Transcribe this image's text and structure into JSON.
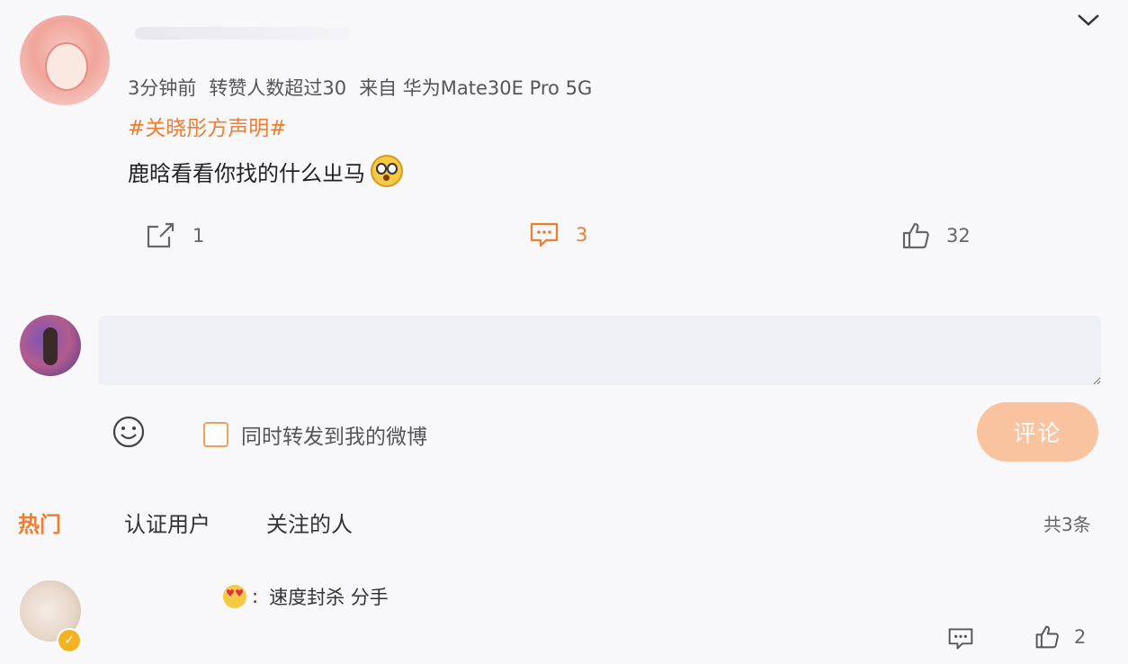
{
  "post": {
    "meta_time": "3分钟前",
    "meta_popular": "转赞人数超过30",
    "meta_source": "来自 华为Mate30E Pro 5G",
    "hashtag": "#关晓彤方声明#",
    "text": "鹿晗看看你找的什么ㄓ马",
    "emoji": "shock-face-emoji",
    "repost_count": "1",
    "comment_count": "3",
    "like_count": "32"
  },
  "composer": {
    "placeholder": "",
    "forward_label": "同时转发到我的微博",
    "submit_label": "评论"
  },
  "comments_header": {
    "tabs": [
      "热门",
      "认证用户",
      "关注的人"
    ],
    "active_tab": "热门",
    "total": "共3条"
  },
  "reply": {
    "prefix": ":",
    "text": "速度封杀 分手",
    "like_count": "2",
    "emoji": "heart-eyes-emoji"
  },
  "colors": {
    "accent": "#f07c30",
    "submit_bg": "#f9c3a0",
    "input_bg": "#eef0f5",
    "background": "#f8f8fb"
  },
  "icons": {
    "expand": "chevron-down-icon",
    "repost": "share-icon",
    "comment": "comment-icon",
    "like": "thumbs-up-icon",
    "emoji_picker": "smile-icon",
    "verified": "verified-badge-icon"
  }
}
